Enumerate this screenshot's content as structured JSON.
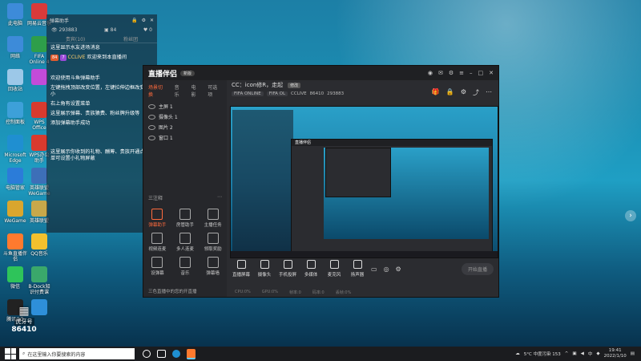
{
  "desktop": {
    "icons": [
      {
        "label": "此电脑",
        "color": "#3d8bd9"
      },
      {
        "label": "网易云音乐",
        "color": "#d93a3a"
      },
      {
        "label": "网络",
        "color": "#3d8bd9"
      },
      {
        "label": "FIFA Online 4",
        "color": "#2e9e4a"
      },
      {
        "label": "回收站",
        "color": "#9cc8e8"
      },
      {
        "label": "",
        "color": "#c24bd9"
      },
      {
        "label": "控制面板",
        "color": "#3da0d9"
      },
      {
        "label": "WPS Office",
        "color": "#d93a2e"
      },
      {
        "label": "Microsoft Edge",
        "color": "#1f8fd1"
      },
      {
        "label": "WPS办公助手",
        "color": "#d93a2e"
      },
      {
        "label": "电脑管家",
        "color": "#2b7cd9"
      },
      {
        "label": "英雄联盟WeGame",
        "color": "#3d6fb8"
      },
      {
        "label": "WeGame",
        "color": "#d9a62e"
      },
      {
        "label": "英雄联盟",
        "color": "#c8a84a"
      },
      {
        "label": "斗鱼直播伴侣",
        "color": "#ff7a2e"
      },
      {
        "label": "QQ音乐",
        "color": "#f2c12e"
      },
      {
        "label": "微信",
        "color": "#2ec45a"
      },
      {
        "label": "B-Dock知识付费课",
        "color": "#3aa86b"
      },
      {
        "label": "腾讯QQ",
        "color": "#222222"
      },
      {
        "label": "",
        "color": "#2e8fd9"
      }
    ]
  },
  "chat": {
    "title": "弹幕助手",
    "stats": {
      "viewers": "293883",
      "likes": "84",
      "gifts": "0"
    },
    "tabs": [
      "贵宾(10)",
      "粉丝团"
    ],
    "welcome": "这里显示水友进场消息",
    "user_line": {
      "level": "84",
      "badge": "7",
      "name": "CCLIVE",
      "text": "欢迎来到本直播间"
    },
    "tips": [
      "欢迎使用斗鱼弹幕助手",
      "左键拖拽顶部改变位置，左键拉伸边框改变大小",
      "右上角有设置菜单",
      "这里展示弹幕、贵族猿费、粉丝牌升级等",
      "添加弹幕助手成功"
    ],
    "gift_tips": "这里展示你收到的礼物、酬筹、贵族开通点菜单可设置小礼物屏蔽"
  },
  "app": {
    "logo": "直播伴侣",
    "version": "新版",
    "left_tabs": [
      "场景切换",
      "音乐",
      "电影",
      "可选项"
    ],
    "scenes": [
      "主屏 1",
      "摄像头 1",
      "图片 2",
      "窗口 1"
    ],
    "tools": [
      {
        "label": "弹幕助手",
        "hot": true
      },
      {
        "label": "房管助手",
        "hot": false
      },
      {
        "label": "主播任务",
        "hot": false
      },
      {
        "label": "视频连麦",
        "hot": false
      },
      {
        "label": "多人连麦",
        "hot": false
      },
      {
        "label": "领取奖励",
        "hot": false
      },
      {
        "label": "设弹幕",
        "hot": false
      },
      {
        "label": "音乐",
        "hot": false
      },
      {
        "label": "弹幕墙",
        "hot": false
      }
    ],
    "collapse": "三注释",
    "bottom_note": "三色直播中的您的开直播",
    "room_title": "CC：icon修R，走起",
    "room_edit": "修改",
    "room_tags": [
      "FIFA ONLINE",
      "FIFA OL",
      "CCLIVE",
      "86410",
      "293883"
    ],
    "controls": [
      "直播屏幕",
      "摄像头",
      "手机投屏",
      "多媒体",
      "麦克风",
      "扬声器"
    ],
    "start_live": "开始直播",
    "status": [
      "CPU:0%",
      "GPU:0%",
      "帧率:0",
      "码率:0",
      "丢帧:0%"
    ]
  },
  "overlay_brand": {
    "name": "虎牙号",
    "number": "86410"
  },
  "taskbar": {
    "search_placeholder": "在这里输入你要搜索的内容",
    "weather": "5°C 中度污染 153",
    "ime": "中",
    "time": "19:41",
    "date": "2022/1/10"
  }
}
